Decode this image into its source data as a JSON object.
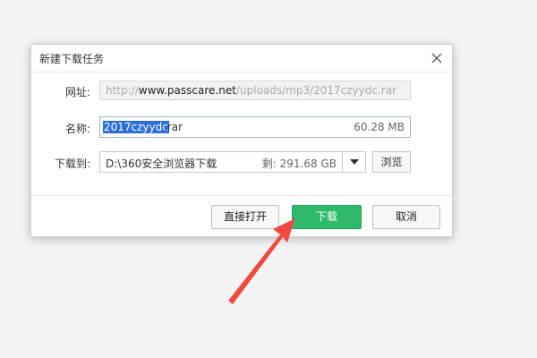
{
  "dialog": {
    "title": "新建下载任务",
    "url_label": "网址:",
    "url_prefix": "http://",
    "url_domain": "www.passcare.net",
    "url_path": "/uploads/mp3/2017czyydc.rar",
    "name_label": "名称:",
    "name_selected": "2017czyydc",
    "name_ext": ".rar",
    "file_size": "60.28 MB",
    "save_label": "下载到:",
    "save_path": "D:\\360安全浏览器下载",
    "free_space": "剩: 291.68 GB",
    "browse_label": "浏览",
    "open_label": "直接打开",
    "download_label": "下载",
    "cancel_label": "取消"
  },
  "colors": {
    "accent": "#2fb96a",
    "selection": "#2c6fd6",
    "arrow": "#f04a3e"
  },
  "icons": {
    "close": "close-icon",
    "dropdown": "chevron-down-icon"
  }
}
